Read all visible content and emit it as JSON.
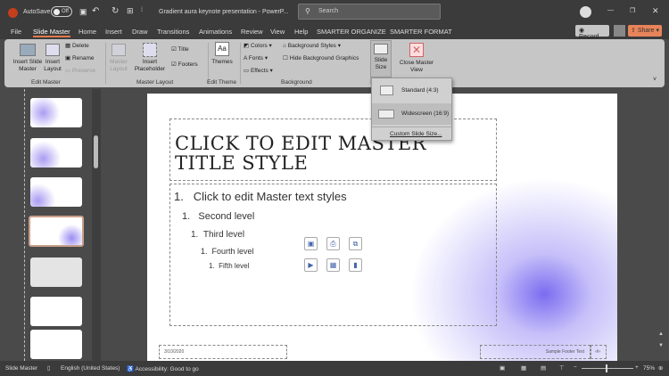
{
  "titlebar": {
    "autosave_label": "AutoSave",
    "autosave_state": "Off",
    "doc_title": "Gradient aura keynote presentation - PowerP...",
    "search_placeholder": "Search"
  },
  "tabs": [
    "File",
    "Slide Master",
    "Home",
    "Insert",
    "Draw",
    "Transitions",
    "Animations",
    "Review",
    "View",
    "Help",
    "SMARTER ORGANIZE",
    "SMARTER FORMAT"
  ],
  "actions": {
    "record": "Record",
    "share": "Share"
  },
  "ribbon": {
    "insert_slide_master": "Insert Slide Master",
    "insert_layout": "Insert Layout",
    "delete": "Delete",
    "rename": "Rename",
    "preserve": "Preserve",
    "group_edit_master": "Edit Master",
    "master_layout": "Master Layout",
    "insert_placeholder": "Insert Placeholder",
    "title": "Title",
    "footers": "Footers",
    "group_master_layout": "Master Layout",
    "themes": "Themes",
    "group_edit_theme": "Edit Theme",
    "colors": "Colors",
    "fonts": "Fonts",
    "effects": "Effects",
    "background_styles": "Background Styles",
    "hide_bg": "Hide Background Graphics",
    "group_background": "Background",
    "slide_size": "Slide Size",
    "close_master": "Close Master View"
  },
  "dropdown": {
    "standard": "Standard (4:3)",
    "widescreen": "Widescreen (16:9)",
    "custom": "Custom Slide Size..."
  },
  "slide": {
    "title": "CLICK TO EDIT MASTER TITLE STYLE",
    "levels": [
      {
        "num": "1.",
        "text": "Click to edit Master text styles"
      },
      {
        "num": "1.",
        "text": "Second level"
      },
      {
        "num": "1.",
        "text": "Third level"
      },
      {
        "num": "1.",
        "text": "Fourth level"
      },
      {
        "num": "1.",
        "text": "Fifth level"
      }
    ],
    "date": "3/10/2020",
    "footer": "Sample Footer Text",
    "page": "‹#›",
    "accent": "#7b6cf0"
  },
  "status": {
    "mode": "Slide Master",
    "language": "English (United States)",
    "accessibility": "Accessibility: Good to go",
    "zoom": "75%"
  }
}
